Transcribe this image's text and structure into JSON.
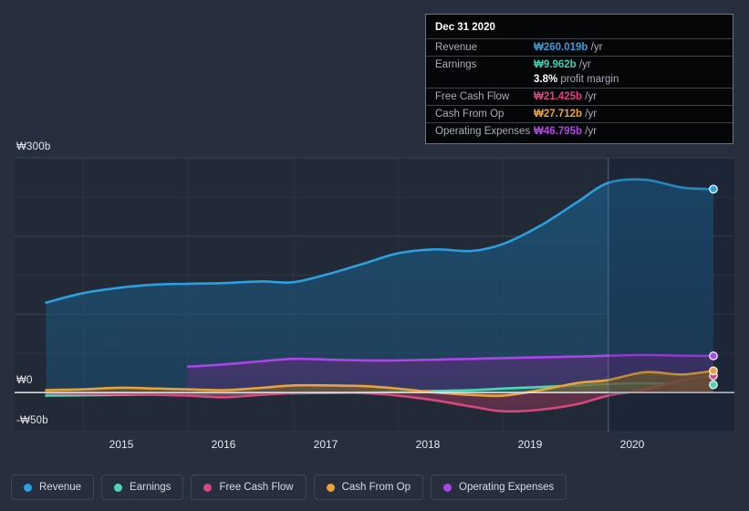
{
  "theme": {
    "background": "#272e3d",
    "plot_background": "#222a38",
    "gridline": "#3c4454",
    "zero_line": "#e8eaee",
    "axis_text": "#e6e9ee"
  },
  "axes": {
    "y_ticks": [
      {
        "label": "₩300b",
        "value": 300
      },
      {
        "label": "₩0",
        "value": 0
      },
      {
        "label": "-₩50b",
        "value": -50
      }
    ],
    "y_min": -50,
    "y_max": 300,
    "x_ticks": [
      "2015",
      "2016",
      "2017",
      "2018",
      "2019",
      "2020"
    ],
    "x_min": 2014.35,
    "x_max": 2021.2
  },
  "tooltip": {
    "date": "Dec 31 2020",
    "rows": [
      {
        "label": "Revenue",
        "value": "₩260.019b",
        "unit": "/yr",
        "color": "#2c9fe0"
      },
      {
        "label": "Earnings",
        "value": "₩9.962b",
        "unit": "/yr",
        "color": "#3ecfb2"
      },
      {
        "label": "",
        "value": "3.8%",
        "unit": "profit margin",
        "color": "#ffffff"
      },
      {
        "label": "Free Cash Flow",
        "value": "₩21.425b",
        "unit": "/yr",
        "color": "#e2447f"
      },
      {
        "label": "Cash From Op",
        "value": "₩27.712b",
        "unit": "/yr",
        "color": "#e8a33d"
      },
      {
        "label": "Operating Expenses",
        "value": "₩46.795b",
        "unit": "/yr",
        "color": "#b445e8"
      }
    ]
  },
  "legend": {
    "items": [
      {
        "label": "Revenue",
        "color": "#2c9fe0"
      },
      {
        "label": "Earnings",
        "color": "#4dd6b4"
      },
      {
        "label": "Free Cash Flow",
        "color": "#d8477e"
      },
      {
        "label": "Cash From Op",
        "color": "#e8a33d"
      },
      {
        "label": "Operating Expenses",
        "color": "#a946e8"
      }
    ]
  },
  "chart_data": {
    "type": "area",
    "title": "",
    "xlabel": "",
    "ylabel": "",
    "ylim": [
      -50,
      300
    ],
    "grid": true,
    "legend_position": "bottom-left",
    "currency": "KRW billions",
    "hover_x": 2020.0,
    "annotations": [
      "Dec 31 2020 tooltip showing values at the hovered date"
    ],
    "x": [
      2014.65,
      2015.0,
      2015.35,
      2015.7,
      2016.0,
      2016.35,
      2016.7,
      2017.0,
      2017.35,
      2017.7,
      2018.0,
      2018.35,
      2018.7,
      2019.0,
      2019.35,
      2019.7,
      2020.0,
      2020.35,
      2020.7,
      2021.0
    ],
    "series": [
      {
        "name": "Revenue",
        "color": "#2c9fe0",
        "fill": "#1d4f72",
        "values": [
          115,
          127,
          134,
          138,
          139,
          140,
          142,
          141,
          152,
          166,
          178,
          183,
          181,
          190,
          213,
          243,
          268,
          272,
          262,
          260.019
        ]
      },
      {
        "name": "Earnings",
        "color": "#4dd6b4",
        "fill": "#2e6f68",
        "values": [
          -4,
          -3.5,
          -3,
          -2.5,
          -2,
          -1.5,
          -1.5,
          -1,
          -0.5,
          0,
          1,
          2,
          3,
          5,
          7,
          9,
          11,
          12,
          10.5,
          9.962
        ]
      },
      {
        "name": "Free Cash Flow",
        "color": "#d8477e",
        "fill": "#7a3352",
        "values": [
          -1,
          -1.5,
          -2,
          -3,
          -4,
          -6,
          -3,
          -1,
          0,
          -1,
          -4,
          -10,
          -18,
          -24,
          -22,
          -15,
          -4,
          4,
          16,
          21.425
        ]
      },
      {
        "name": "Cash From Op",
        "color": "#e8a33d",
        "fill": "#7a5f33",
        "values": [
          3,
          4,
          6,
          5,
          4,
          3,
          6,
          9,
          9,
          8,
          5,
          0,
          -3,
          -4,
          3,
          12,
          16,
          26,
          23,
          27.712
        ]
      },
      {
        "name": "Operating Expenses",
        "color": "#a946e8",
        "fill": "#4a3470",
        "start_index": 4,
        "values": [
          null,
          null,
          null,
          null,
          33,
          36,
          40,
          43,
          42,
          41,
          41,
          42,
          43,
          44,
          45,
          46,
          47,
          48,
          47,
          46.795
        ]
      }
    ]
  }
}
